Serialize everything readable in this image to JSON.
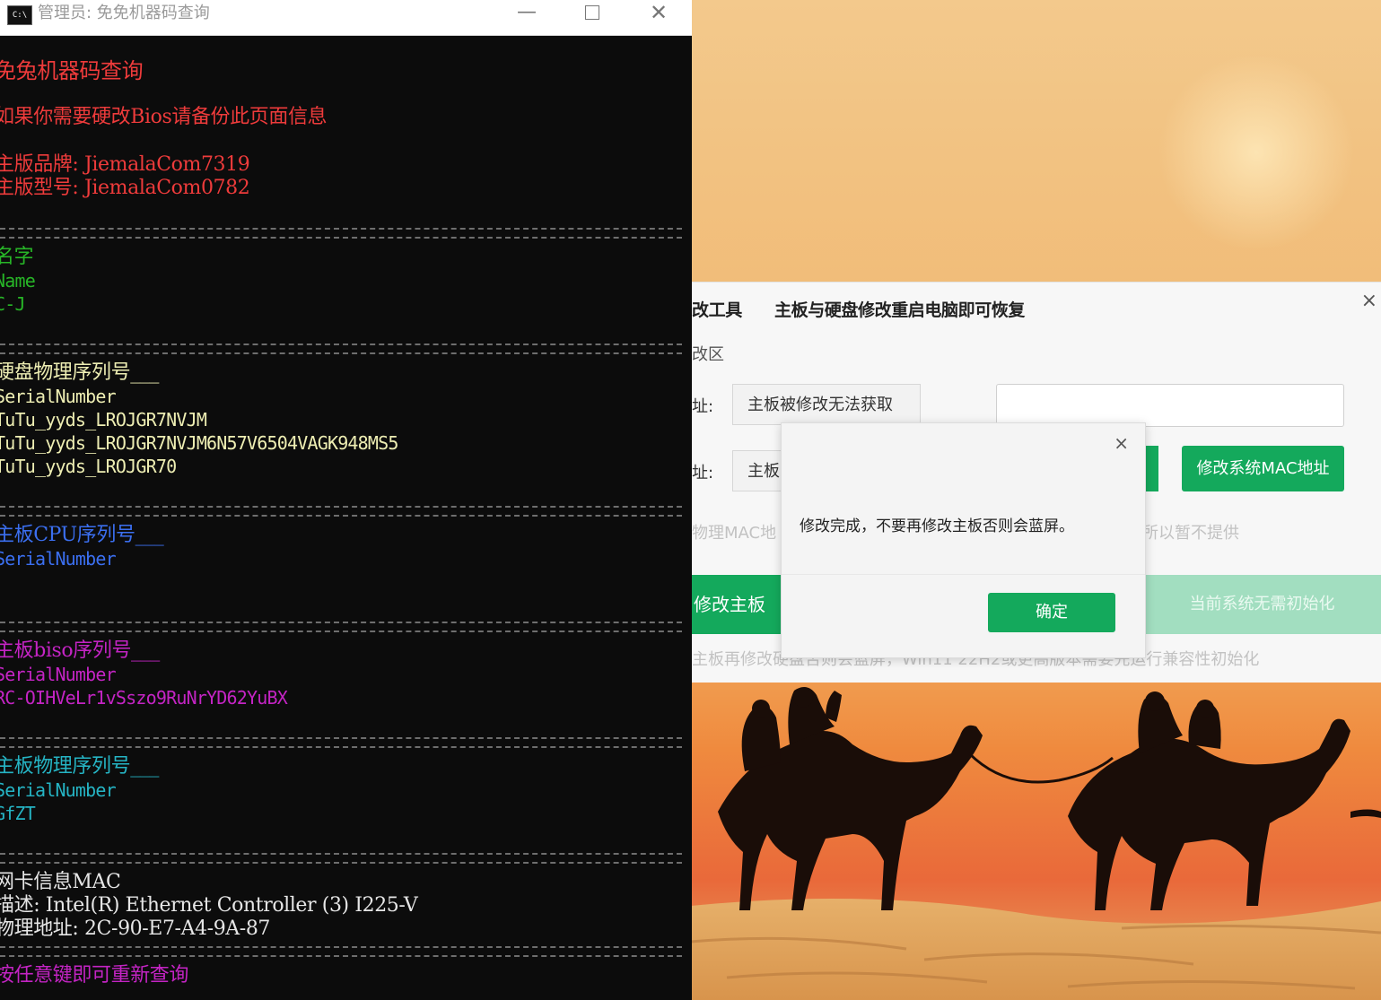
{
  "console": {
    "window_title": "管理员: 免免机器码查询",
    "icon_text": "C:\\",
    "controls": {
      "minimize": "—",
      "close": "✕"
    },
    "heading": "免兔机器码查询",
    "notice": "如果你需要硬改Bios请备份此页面信息",
    "board_brand": "主版品牌: JiemalaCom7319",
    "board_model": "主版型号: JiemalaCom0782",
    "name_section": {
      "title": "名字",
      "label": "Name",
      "value": "C-J"
    },
    "disk_section": {
      "title": "硬盘物理序列号___",
      "label": "SerialNumber",
      "values": [
        "TuTu_yyds_LROJGR7NVJM",
        "TuTu_yyds_LROJGR7NVJM6N57V6504VAGK948MS5",
        "TuTu_yyds_LROJGR70"
      ]
    },
    "cpu_section": {
      "title": "主板CPU序列号___",
      "label": "SerialNumber"
    },
    "bios_section": {
      "title": "主板biso序列号___",
      "label": "SerialNumber",
      "value": "RC-OIHVeLr1vSszo9RuNrYD62YuBX"
    },
    "board_serial_section": {
      "title": "主板物理序列号___",
      "label": "SerialNumber",
      "value": "GfZT"
    },
    "nic_section": {
      "title": "网卡信息MAC",
      "description": "描述: Intel(R) Ethernet Controller (3) I225-V",
      "address": "物理地址: 2C-90-E7-A4-9A-87"
    },
    "footer": "按任意键即可重新查询"
  },
  "tool": {
    "title_partial": "改工具",
    "subtitle": "主板与硬盘修改重启电脑即可恢复",
    "close": "×",
    "section_label": "改区",
    "address_label_1": "址:",
    "address_label_2": "址:",
    "board_field_1": "主板被修改无法获取",
    "board_field_2": "主板",
    "mac_button": "修改系统MAC地址",
    "hint_left": "物理MAC地",
    "hint_right": "所以暂不提供",
    "modify_board_button": "修改主板",
    "init_button": "当前系统无需初始化",
    "footer_note": "主板再修改硬盘否则会蓝屏，Win11 22H2或更高版本需要先运行兼容性初始化"
  },
  "dialog": {
    "close": "×",
    "message": "修改完成，不要再修改主板否则会蓝屏。",
    "ok_button": "确定"
  },
  "colors": {
    "console_bg": "#0c0c0c",
    "accent_green": "#14a95c",
    "disabled_green": "#a2dec0"
  }
}
